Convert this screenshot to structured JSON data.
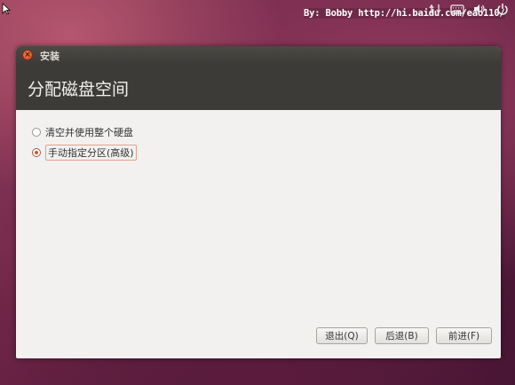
{
  "panel": {
    "watermark": "By: Bobby http://hi.baidu.com/eao110/",
    "tray_icons": [
      "network-icon",
      "keyboard-icon",
      "volume-icon",
      "power-icon"
    ]
  },
  "window": {
    "title": "安装",
    "page_title": "分配磁盘空间",
    "options": [
      {
        "label": "清空并使用整个硬盘",
        "selected": false
      },
      {
        "label": "手动指定分区(高级)",
        "selected": true
      }
    ],
    "buttons": {
      "quit": "退出(Q)",
      "back": "后退(B)",
      "forward": "前进(F)"
    }
  },
  "colors": {
    "accent": "#d9532d",
    "header_bg": "#3c3b37",
    "window_bg": "#f2f1f0"
  }
}
